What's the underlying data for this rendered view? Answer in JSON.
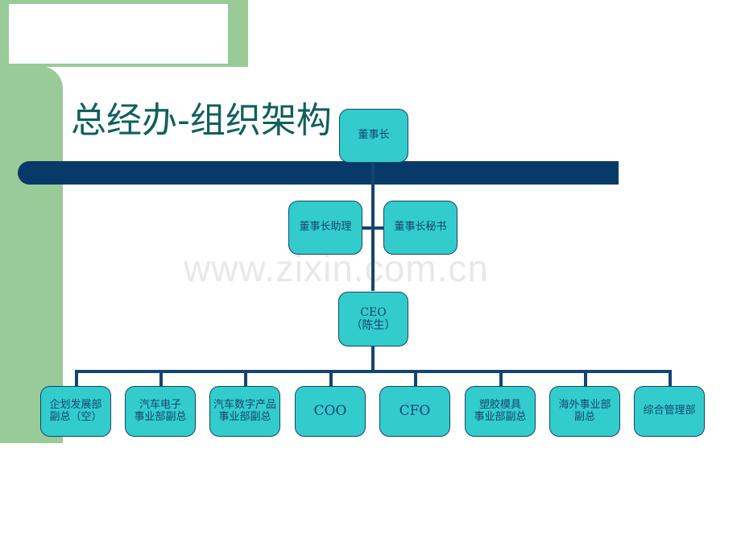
{
  "slide": {
    "title": "总经办-组织架构",
    "watermark": "www.zixin.com.cn",
    "accent_green": "#98CB97",
    "accent_navy": "#083A69",
    "node_fill": "#33CCCC",
    "node_border": "#14456F",
    "title_color": "#10605C",
    "watermark_color": "#E8E8E8"
  },
  "org_chart": {
    "type": "diagram",
    "root": {
      "id": "chairman",
      "label": "董事长"
    },
    "staff_row": [
      {
        "id": "chairman-assistant",
        "label": "董事长助理"
      },
      {
        "id": "chairman-secretary",
        "label": "董事长秘书"
      }
    ],
    "ceo": {
      "id": "ceo",
      "label": "CEO\n（陈生）",
      "line1": "CEO",
      "line2": "（陈生）"
    },
    "divisions": [
      {
        "id": "planning-development-vp",
        "label": "企划发展部\n副总（空）"
      },
      {
        "id": "auto-electronics-vp",
        "label": "汽车电子\n事业部副总"
      },
      {
        "id": "auto-digital-products-vp",
        "label": "汽车数字产品\n事业部副总"
      },
      {
        "id": "coo",
        "label": "COO"
      },
      {
        "id": "cfo",
        "label": "CFO"
      },
      {
        "id": "plastic-mold-vp",
        "label": "塑胶模具\n事业部副总"
      },
      {
        "id": "overseas-business-vp",
        "label": "海外事业部\n副总"
      },
      {
        "id": "general-management-dept",
        "label": "综合管理部"
      }
    ]
  }
}
